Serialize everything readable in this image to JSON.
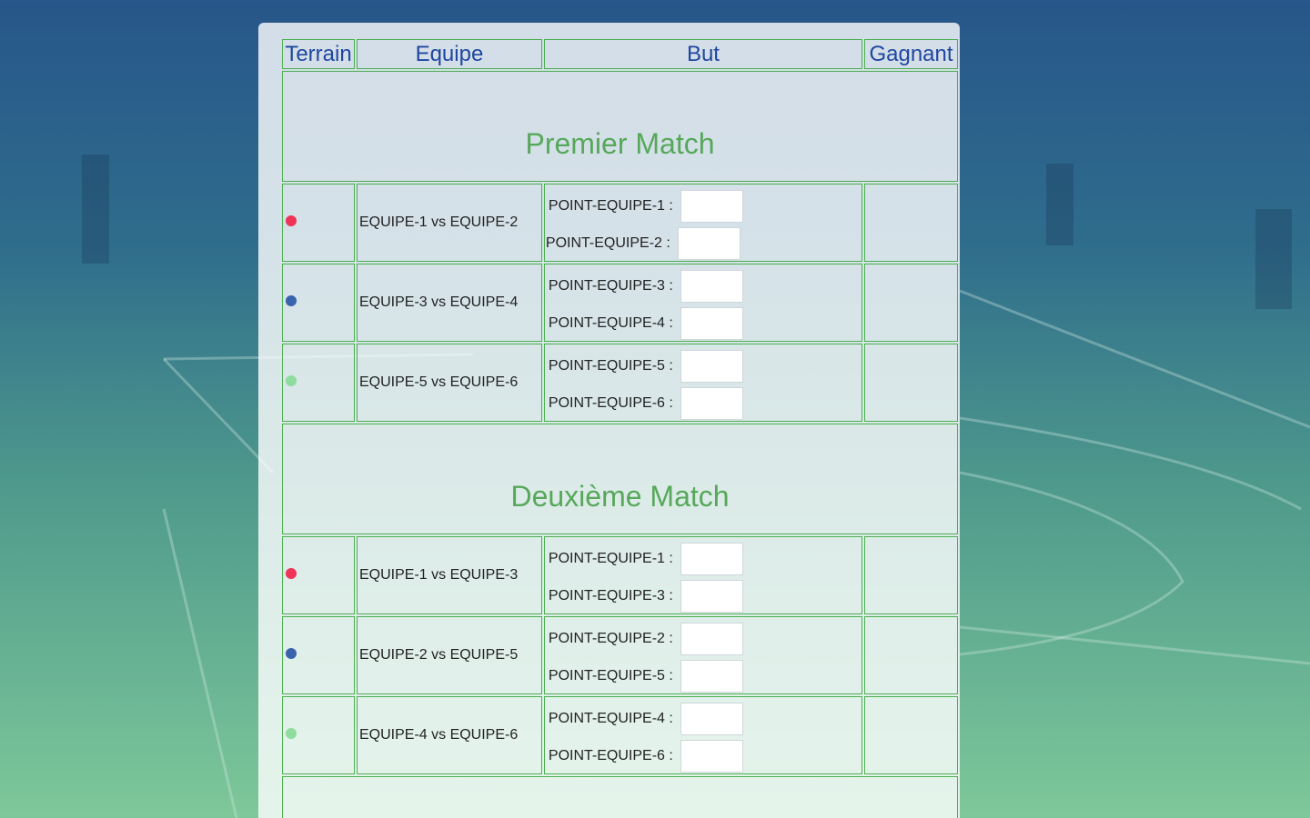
{
  "headers": {
    "terrain": "Terrain",
    "equipe": "Equipe",
    "but": "But",
    "gagnant": "Gagnant"
  },
  "colors": {
    "red": "#ee3457",
    "blue": "#3a63ad",
    "green": "#8edc9e",
    "title": "#57a85b",
    "header": "#1f47a0",
    "border": "#4caf50"
  },
  "sections": [
    {
      "title": "Premier Match",
      "rows": [
        {
          "terrain_color": "red",
          "match": "EQUIPE-1 vs EQUIPE-2",
          "label_a": "POINT-EQUIPE-1 :",
          "value_a": "",
          "label_b": "POINT-EQUIPE-2 :",
          "value_b": "",
          "gagnant": ""
        },
        {
          "terrain_color": "blue",
          "match": "EQUIPE-3 vs EQUIPE-4",
          "label_a": "POINT-EQUIPE-3 :",
          "value_a": "",
          "label_b": "POINT-EQUIPE-4 :",
          "value_b": "",
          "gagnant": ""
        },
        {
          "terrain_color": "green",
          "match": "EQUIPE-5 vs EQUIPE-6",
          "label_a": "POINT-EQUIPE-5 :",
          "value_a": "",
          "label_b": "POINT-EQUIPE-6 :",
          "value_b": "",
          "gagnant": ""
        }
      ]
    },
    {
      "title": "Deuxième Match",
      "rows": [
        {
          "terrain_color": "red",
          "match": "EQUIPE-1 vs EQUIPE-3",
          "label_a": "POINT-EQUIPE-1 :",
          "value_a": "",
          "label_b": "POINT-EQUIPE-3 :",
          "value_b": "",
          "gagnant": ""
        },
        {
          "terrain_color": "blue",
          "match": "EQUIPE-2 vs EQUIPE-5",
          "label_a": "POINT-EQUIPE-2 :",
          "value_a": "",
          "label_b": "POINT-EQUIPE-5 :",
          "value_b": "",
          "gagnant": ""
        },
        {
          "terrain_color": "green",
          "match": "EQUIPE-4 vs EQUIPE-6",
          "label_a": "POINT-EQUIPE-4 :",
          "value_a": "",
          "label_b": "POINT-EQUIPE-6 :",
          "value_b": "",
          "gagnant": ""
        }
      ]
    }
  ]
}
